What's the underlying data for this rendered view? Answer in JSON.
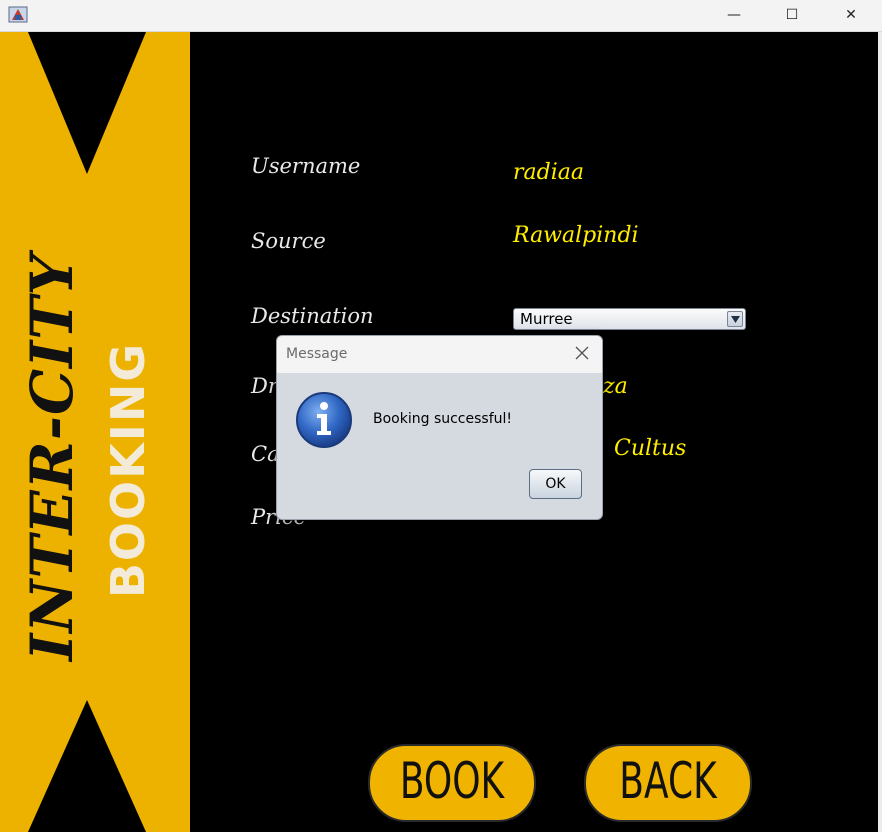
{
  "window": {
    "minimize_glyph": "—",
    "maximize_glyph": "☐",
    "close_glyph": "✕"
  },
  "banner": {
    "line1": "INTER-CITY",
    "line2": "BOOKING",
    "color": "#edb200"
  },
  "form": {
    "username": {
      "label": "Username",
      "value": "radiaa"
    },
    "source": {
      "label": "Source",
      "value": "Rawalpindi"
    },
    "destination": {
      "label": "Destination",
      "selected": "Murree"
    },
    "driver": {
      "label_visible": "Dr",
      "value_visible": "za"
    },
    "car": {
      "label_visible": "Ca",
      "value_visible": "Cultus"
    },
    "price": {
      "label_visible": "Price"
    }
  },
  "buttons": {
    "book": "BOOK",
    "back": "BACK"
  },
  "dialog": {
    "title": "Message",
    "message": "Booking successful!",
    "ok": "OK",
    "icon": "info-icon"
  },
  "colors": {
    "accent_yellow": "#edb200",
    "value_text": "#ffee00",
    "background": "#000000"
  }
}
